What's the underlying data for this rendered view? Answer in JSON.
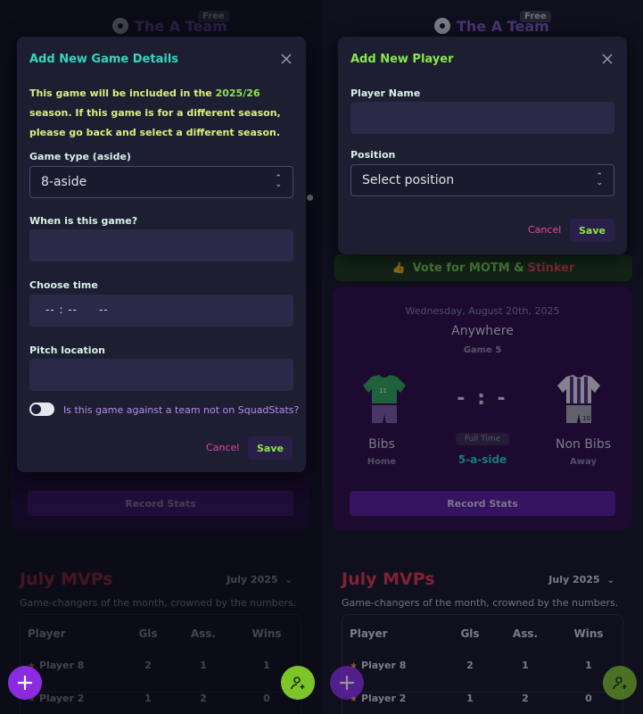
{
  "app": {
    "brand_name": "The A Team",
    "plan_badge": "Free",
    "motm_banner": {
      "vote_text": "Vote for MOTM &",
      "stinker_text": "Stinker"
    },
    "match": {
      "date": "Wednesday, August 20th, 2025",
      "venue": "Anywhere",
      "game_number": "Game 5",
      "score": "- : -",
      "status": "Full Time",
      "format": "5-a-side",
      "home_team": "Bibs",
      "home_role": "Home",
      "away_team": "Non Bibs",
      "away_role": "Away",
      "home_kit_number": "11",
      "away_kit_number": "10",
      "record_button": "Record Stats"
    },
    "mvp": {
      "title": "July MVPs",
      "month_selector": "July 2025",
      "subtitle": "Game-changers of the month, crowned by the numbers.",
      "columns": [
        "Player",
        "Gls",
        "Ass.",
        "Wins"
      ],
      "rows": [
        [
          "Player 8",
          "2",
          "1",
          "1"
        ],
        [
          "Player 2",
          "1",
          "2",
          "0"
        ]
      ]
    }
  },
  "game_modal": {
    "title": "Add New Game Details",
    "notice_prefix": "This game will be included in the",
    "notice_season": "2025/26",
    "notice_suffix": "season. If this game is for a different season, please go back and select a different season.",
    "game_type_label": "Game type (aside)",
    "game_type_value": "8-aside",
    "date_label": "When is this game?",
    "date_value": "",
    "time_label": "Choose time",
    "time_value": "-- : --     --",
    "pitch_label": "Pitch location",
    "pitch_value": "",
    "toggle_label": "Is this game against a team not on SquadStats?",
    "toggle_on": false,
    "cancel": "Cancel",
    "save": "Save"
  },
  "player_modal": {
    "title": "Add New Player",
    "name_label": "Player Name",
    "name_value": "",
    "position_label": "Position",
    "position_placeholder": "Select position",
    "cancel": "Cancel",
    "save": "Save"
  },
  "colors": {
    "accent_teal": "#33d6bf",
    "accent_green": "#8ae64d",
    "accent_purple": "#8a2be2",
    "accent_red": "#e2334a",
    "cancel_pink": "#e04a9a"
  }
}
